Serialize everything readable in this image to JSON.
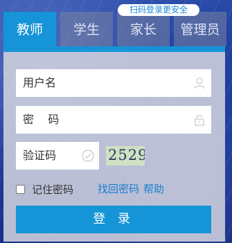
{
  "qr_hint": "扫码登录更安全",
  "tabs": [
    {
      "label": "教师",
      "active": true
    },
    {
      "label": "学生",
      "active": false
    },
    {
      "label": "家长",
      "active": false
    },
    {
      "label": "管理员",
      "active": false
    }
  ],
  "form": {
    "username_placeholder": "用户名",
    "password_placeholder": "密    码",
    "captcha_placeholder": "验证码",
    "captcha_text": "2529",
    "remember_label": "记住密码",
    "remember_checked": false,
    "find_password_link": "找回密码",
    "help_link": "帮助",
    "login_button": "登 录"
  },
  "colors": {
    "accent": "#1594d8",
    "link": "#1a7fd0"
  },
  "icons": {
    "username": "user-icon",
    "password": "lock-icon",
    "captcha": "check-circle-icon"
  }
}
